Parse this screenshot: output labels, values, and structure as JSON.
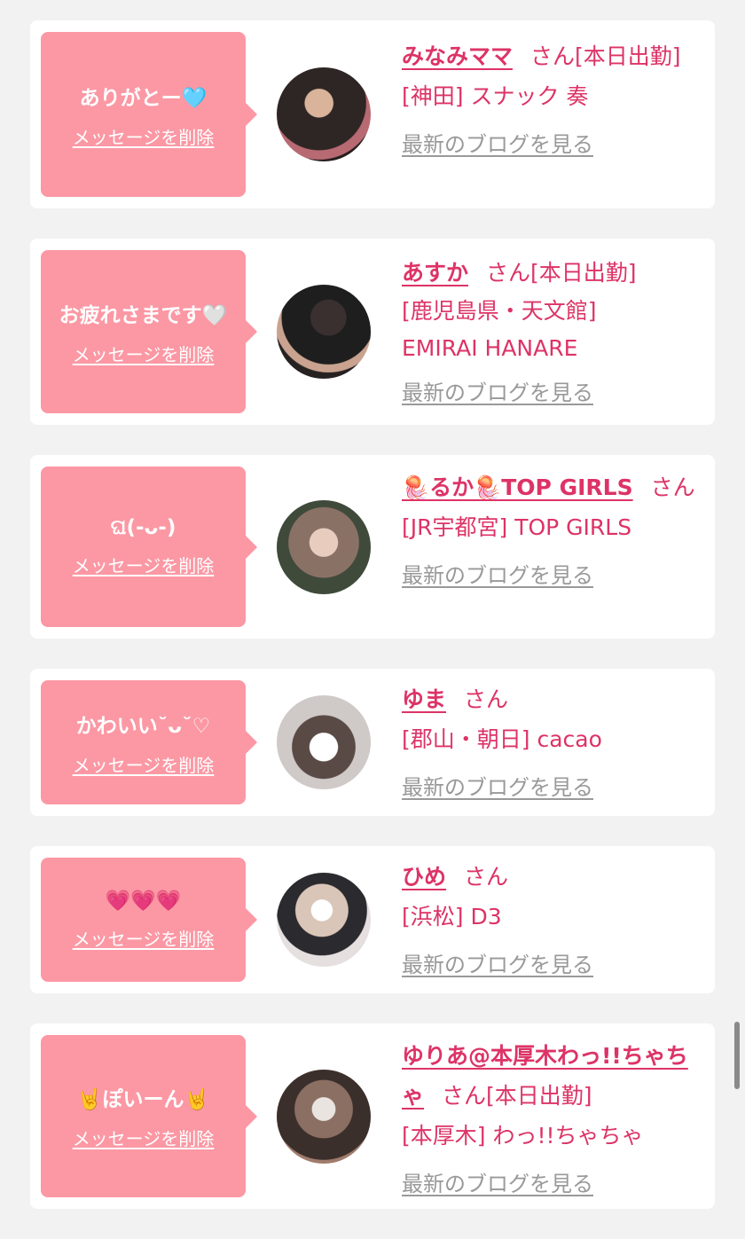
{
  "cards": [
    {
      "message": "ありがとー🩵",
      "delete_label": "メッセージを削除",
      "name": "みなみママ",
      "suffix": "さん[本日出勤]",
      "shop": "[神田] スナック 奏",
      "blog_label": "最新のブログを見る",
      "avatar_color": "#3a2f2c"
    },
    {
      "message": "お疲れさまです🤍",
      "delete_label": "メッセージを削除",
      "name": "あすか",
      "suffix": "さん[本日出勤]",
      "shop": "[鹿児島県・天文館] EMIRAI HANARE",
      "blog_label": "最新のブログを見る",
      "avatar_color": "#222222"
    },
    {
      "message": "ଘ(-ᴗ-)",
      "delete_label": "メッセージを削除",
      "name": "🪼るか🪼TOP GIRLS",
      "suffix": "さん",
      "shop": "[JR宇都宮] TOP GIRLS",
      "blog_label": "最新のブログを見る",
      "avatar_color": "#6b5a55"
    },
    {
      "message": "かわいい˘ᴗ˘♡",
      "delete_label": "メッセージを削除",
      "name": "ゆま",
      "suffix": "さん",
      "shop": "[郡山・朝日] cacao",
      "blog_label": "最新のブログを見る",
      "avatar_color": "#d8d4d2"
    },
    {
      "message": "💗💗💗",
      "delete_label": "メッセージを削除",
      "name": "ひめ",
      "suffix": "さん",
      "shop": "[浜松] D3",
      "blog_label": "最新のブログを見る",
      "avatar_color": "#b9b2b4"
    },
    {
      "message": "🤘ぽいーん🤘",
      "delete_label": "メッセージを削除",
      "name": "ゆりあ@本厚木わっ!!ちゃちゃ",
      "suffix": "さん[本日出勤]",
      "shop": "[本厚木] わっ!!ちゃちゃ",
      "blog_label": "最新のブログを見る",
      "avatar_color": "#4a3a35"
    }
  ],
  "colors": {
    "background": "#f2f2f2",
    "bubble": "#fb98a4",
    "accent": "#dd3366",
    "muted": "#999999"
  }
}
